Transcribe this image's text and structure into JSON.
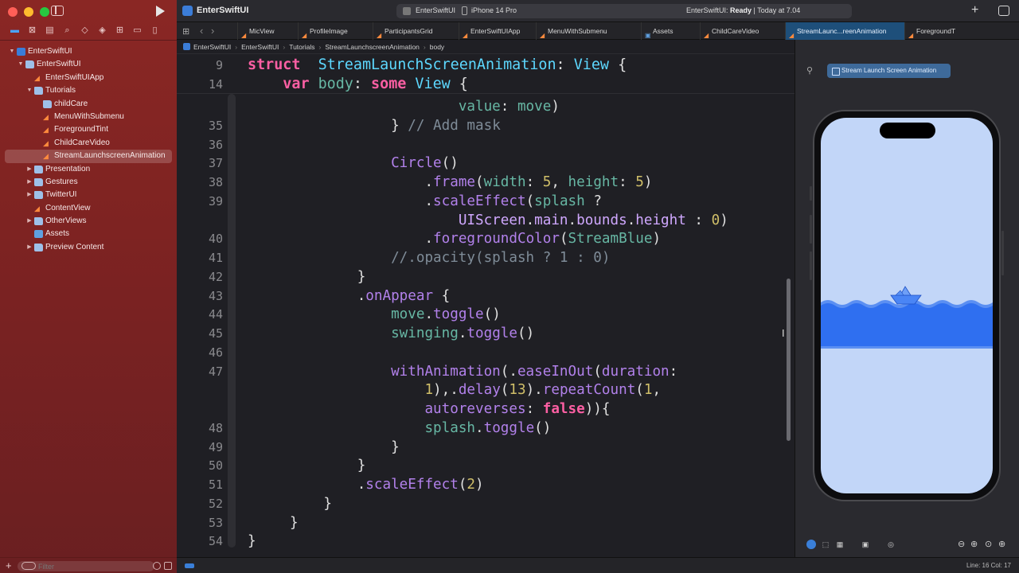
{
  "app": {
    "project_title": "EnterSwiftUI"
  },
  "toolbar": {
    "scheme": "EnterSwiftUI",
    "device": "iPhone 14 Pro",
    "status_prefix": "EnterSwiftUI: ",
    "status_state": "Ready",
    "status_time": " | Today at 7.04"
  },
  "tabs": [
    "MicView",
    "ProfileImage",
    "ParticipantsGrid",
    "EnterSwiftUIApp",
    "MenuWithSubmenu",
    "Assets",
    "ChildCareVideo",
    "StreamLaunc...reenAnimation",
    "ForegroundT"
  ],
  "breadcrumb": [
    "EnterSwiftUI",
    "EnterSwiftUI",
    "Tutorials",
    "StreamLaunchscreenAnimation",
    "body"
  ],
  "navigator": {
    "items": [
      {
        "label": "EnterSwiftUI",
        "level": 0,
        "icon": "project",
        "disclosure": "open"
      },
      {
        "label": "EnterSwiftUI",
        "level": 1,
        "icon": "folder",
        "disclosure": "open"
      },
      {
        "label": "EnterSwiftUIApp",
        "level": 2,
        "icon": "swift",
        "disclosure": ""
      },
      {
        "label": "Tutorials",
        "level": 2,
        "icon": "folder",
        "disclosure": "open"
      },
      {
        "label": "childCare",
        "level": 3,
        "icon": "folder",
        "disclosure": ""
      },
      {
        "label": "MenuWithSubmenu",
        "level": 3,
        "icon": "swift",
        "disclosure": ""
      },
      {
        "label": "ForegroundTint",
        "level": 3,
        "icon": "swift",
        "disclosure": ""
      },
      {
        "label": "ChildCareVideo",
        "level": 3,
        "icon": "swift",
        "disclosure": ""
      },
      {
        "label": "StreamLaunchscreenAnimation",
        "level": 3,
        "icon": "swift",
        "disclosure": "",
        "selected": true
      },
      {
        "label": "Presentation",
        "level": 2,
        "icon": "folder",
        "disclosure": "closed"
      },
      {
        "label": "Gestures",
        "level": 2,
        "icon": "folder",
        "disclosure": "closed"
      },
      {
        "label": "TwitterUI",
        "level": 2,
        "icon": "folder",
        "disclosure": "closed"
      },
      {
        "label": "ContentView",
        "level": 2,
        "icon": "swift",
        "disclosure": ""
      },
      {
        "label": "OtherViews",
        "level": 2,
        "icon": "folder",
        "disclosure": "closed"
      },
      {
        "label": "Assets",
        "level": 2,
        "icon": "asset",
        "disclosure": ""
      },
      {
        "label": "Preview Content",
        "level": 2,
        "icon": "folder",
        "disclosure": "closed"
      }
    ],
    "filter_placeholder": "Filter"
  },
  "editor": {
    "sticky": [
      {
        "num": "9",
        "tokens": [
          [
            "kw",
            "struct"
          ],
          [
            "",
            "  "
          ],
          [
            "ty",
            "StreamLaunchScreenAnimation"
          ],
          [
            "",
            ": "
          ],
          [
            "ty",
            "View"
          ],
          [
            "",
            " {"
          ]
        ]
      },
      {
        "num": "14",
        "tokens": [
          [
            "",
            "    "
          ],
          [
            "kw",
            "var"
          ],
          [
            "",
            " "
          ],
          [
            "fn",
            "body"
          ],
          [
            "",
            ": "
          ],
          [
            "kw",
            "some"
          ],
          [
            "",
            " "
          ],
          [
            "ty",
            "View"
          ],
          [
            "",
            " {"
          ]
        ]
      }
    ],
    "lines": [
      {
        "num": "",
        "tokens": [
          [
            "",
            "                         "
          ],
          [
            "fn",
            "value"
          ],
          [
            "",
            ": "
          ],
          [
            "fn",
            "move"
          ],
          [
            "",
            ")"
          ]
        ]
      },
      {
        "num": "35",
        "tokens": [
          [
            "",
            "                 } "
          ],
          [
            "cm",
            "// Add mask"
          ]
        ]
      },
      {
        "num": "36",
        "tokens": []
      },
      {
        "num": "37",
        "tokens": [
          [
            "",
            "                 "
          ],
          [
            "mth",
            "Circle"
          ],
          [
            "",
            "()"
          ]
        ]
      },
      {
        "num": "38",
        "tokens": [
          [
            "",
            "                     ."
          ],
          [
            "mth",
            "frame"
          ],
          [
            "",
            "("
          ],
          [
            "fn",
            "width"
          ],
          [
            "",
            ": "
          ],
          [
            "num",
            "5"
          ],
          [
            "",
            ", "
          ],
          [
            "fn",
            "height"
          ],
          [
            "",
            ": "
          ],
          [
            "num",
            "5"
          ],
          [
            "",
            ")"
          ]
        ]
      },
      {
        "num": "39",
        "tokens": [
          [
            "",
            "                     ."
          ],
          [
            "mth",
            "scaleEffect"
          ],
          [
            "",
            "("
          ],
          [
            "fn",
            "splash"
          ],
          [
            "",
            " ?"
          ]
        ]
      },
      {
        "num": "",
        "tokens": [
          [
            "",
            "                         "
          ],
          [
            "sh",
            "UIScreen"
          ],
          [
            "",
            "."
          ],
          [
            "sh",
            "main"
          ],
          [
            "",
            "."
          ],
          [
            "sh",
            "bounds"
          ],
          [
            "",
            "."
          ],
          [
            "sh",
            "height"
          ],
          [
            "",
            " : "
          ],
          [
            "num",
            "0"
          ],
          [
            "",
            ")"
          ]
        ]
      },
      {
        "num": "40",
        "tokens": [
          [
            "",
            "                     ."
          ],
          [
            "mth",
            "foregroundColor"
          ],
          [
            "",
            "("
          ],
          [
            "fn",
            "StreamBlue"
          ],
          [
            "",
            ")"
          ]
        ]
      },
      {
        "num": "41",
        "tokens": [
          [
            "cm",
            "                 //.opacity(splash ? 1 : 0)"
          ]
        ]
      },
      {
        "num": "42",
        "tokens": [
          [
            "",
            "             }"
          ]
        ]
      },
      {
        "num": "43",
        "tokens": [
          [
            "",
            "             ."
          ],
          [
            "mth",
            "onAppear"
          ],
          [
            "",
            " {"
          ]
        ]
      },
      {
        "num": "44",
        "tokens": [
          [
            "",
            "                 "
          ],
          [
            "fn",
            "move"
          ],
          [
            "",
            "."
          ],
          [
            "mth",
            "toggle"
          ],
          [
            "",
            "()"
          ]
        ]
      },
      {
        "num": "45",
        "tokens": [
          [
            "",
            "                 "
          ],
          [
            "fn",
            "swinging"
          ],
          [
            "",
            "."
          ],
          [
            "mth",
            "toggle"
          ],
          [
            "",
            "()"
          ]
        ]
      },
      {
        "num": "46",
        "tokens": []
      },
      {
        "num": "47",
        "tokens": [
          [
            "",
            "                 "
          ],
          [
            "mth",
            "withAnimation"
          ],
          [
            "",
            "(."
          ],
          [
            "mth",
            "easeInOut"
          ],
          [
            "",
            "("
          ],
          [
            "mth",
            "duration"
          ],
          [
            "",
            ":"
          ]
        ]
      },
      {
        "num": "",
        "tokens": [
          [
            "",
            "                     "
          ],
          [
            "num",
            "1"
          ],
          [
            "",
            "),"
          ],
          [
            "",
            "."
          ],
          [
            "mth",
            "delay"
          ],
          [
            "",
            "("
          ],
          [
            "num",
            "13"
          ],
          [
            "",
            ")."
          ],
          [
            "mth",
            "repeatCount"
          ],
          [
            "",
            "("
          ],
          [
            "num",
            "1"
          ],
          [
            "",
            ","
          ]
        ]
      },
      {
        "num": "",
        "tokens": [
          [
            "",
            "                     "
          ],
          [
            "mth",
            "autoreverses"
          ],
          [
            "",
            ": "
          ],
          [
            "kw",
            "false"
          ],
          [
            "",
            "))"
          ],
          [
            "",
            "{"
          ]
        ]
      },
      {
        "num": "48",
        "tokens": [
          [
            "",
            "                     "
          ],
          [
            "fn",
            "splash"
          ],
          [
            "",
            "."
          ],
          [
            "mth",
            "toggle"
          ],
          [
            "",
            "()"
          ]
        ]
      },
      {
        "num": "49",
        "tokens": [
          [
            "",
            "                 }"
          ]
        ]
      },
      {
        "num": "50",
        "tokens": [
          [
            "",
            "             }"
          ]
        ]
      },
      {
        "num": "51",
        "tokens": [
          [
            "",
            "             ."
          ],
          [
            "mth",
            "scaleEffect"
          ],
          [
            "",
            "("
          ],
          [
            "num",
            "2"
          ],
          [
            "",
            ")"
          ]
        ]
      },
      {
        "num": "52",
        "tokens": [
          [
            "",
            "         }"
          ]
        ]
      },
      {
        "num": "53",
        "tokens": [
          [
            "",
            "     }"
          ]
        ]
      },
      {
        "num": "54",
        "tokens": [
          [
            "",
            "}"
          ]
        ]
      }
    ]
  },
  "canvas": {
    "preview_label": "Stream Launch Screen Animation"
  },
  "statusbar": {
    "position": "Line: 16  Col: 17"
  },
  "colors": {
    "water": "#2f6ff0",
    "sky": "#c2d6f8",
    "accent": "#3a7fd8"
  }
}
